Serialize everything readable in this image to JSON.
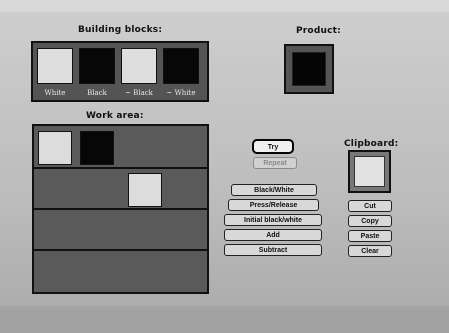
{
  "sections": {
    "building_blocks": "Building blocks:",
    "product": "Product:",
    "work_area": "Work area:",
    "clipboard": "Clipboard:"
  },
  "building_blocks": [
    {
      "label": "White",
      "color": "#dedede"
    },
    {
      "label": "Black",
      "color": "#070707"
    },
    {
      "label": "~ Black",
      "color": "#dedede"
    },
    {
      "label": "~ White",
      "color": "#070707"
    }
  ],
  "buttons": {
    "try": "Try",
    "repeat": "Repeat",
    "black_white": "Black/White",
    "press_release": "Press/Release",
    "initial_black_white": "Initial black/white",
    "add": "Add",
    "subtract": "Subtract",
    "cut": "Cut",
    "copy": "Copy",
    "paste": "Paste",
    "clear": "Clear"
  },
  "colors": {
    "panel": "#545454",
    "black_block": "#070707",
    "white_block": "#dedede"
  }
}
